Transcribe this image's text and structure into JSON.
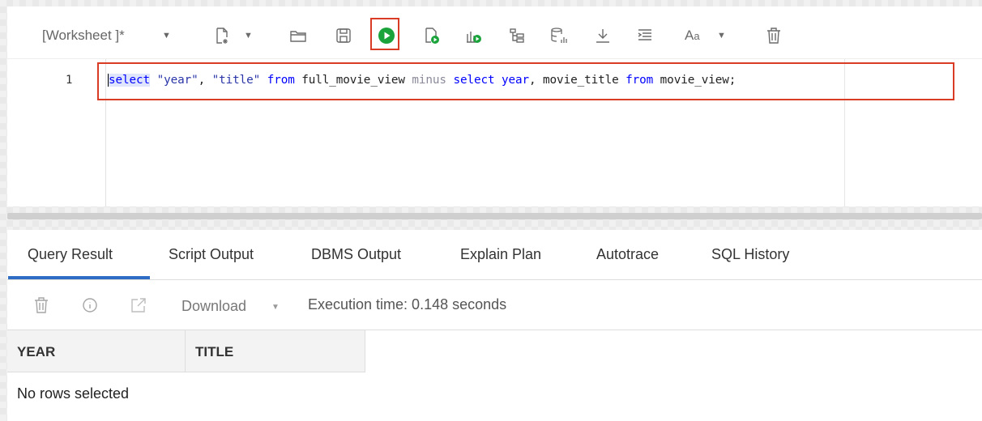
{
  "toolbar": {
    "worksheet_label": "[Worksheet ]*",
    "caret": "▼"
  },
  "editor": {
    "line_number": "1",
    "tokens": [
      {
        "text": "select",
        "kind": "kw"
      },
      {
        "text": " ",
        "kind": "plain"
      },
      {
        "text": "\"year\"",
        "kind": "str"
      },
      {
        "text": ", ",
        "kind": "plain"
      },
      {
        "text": "\"title\"",
        "kind": "str"
      },
      {
        "text": " ",
        "kind": "plain"
      },
      {
        "text": "from",
        "kind": "kw"
      },
      {
        "text": " full_movie_view ",
        "kind": "plain"
      },
      {
        "text": "minus",
        "kind": "kw-muted"
      },
      {
        "text": " ",
        "kind": "plain"
      },
      {
        "text": "select",
        "kind": "kw"
      },
      {
        "text": " ",
        "kind": "plain"
      },
      {
        "text": "year",
        "kind": "kw"
      },
      {
        "text": ", movie_title ",
        "kind": "plain"
      },
      {
        "text": "from",
        "kind": "kw"
      },
      {
        "text": " movie_view;",
        "kind": "plain"
      }
    ]
  },
  "tabs": [
    {
      "label": "Query Result",
      "active": true
    },
    {
      "label": "Script Output",
      "active": false
    },
    {
      "label": "DBMS Output",
      "active": false
    },
    {
      "label": "Explain Plan",
      "active": false
    },
    {
      "label": "Autotrace",
      "active": false
    },
    {
      "label": "SQL History",
      "active": false
    }
  ],
  "result_toolbar": {
    "download_label": "Download",
    "download_caret": "▼",
    "execution_time": "Execution time: 0.148 seconds"
  },
  "grid": {
    "columns": [
      "YEAR",
      "TITLE"
    ],
    "empty_message": "No rows selected"
  },
  "colors": {
    "highlight_border": "#d93b25",
    "active_tab": "#2f6cc4",
    "run_green": "#1aa33b",
    "keyword": "#0000ff"
  }
}
